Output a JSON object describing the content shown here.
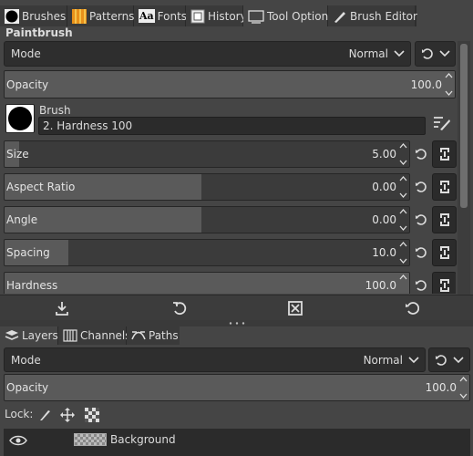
{
  "top_tabs": [
    {
      "label": "Brushes",
      "icon": "brushes-icon"
    },
    {
      "label": "Patterns",
      "icon": "patterns-icon"
    },
    {
      "label": "Fonts",
      "icon": "fonts-icon"
    },
    {
      "label": "History",
      "icon": "history-icon"
    },
    {
      "label": "Tool Options",
      "icon": "tool-options-icon"
    },
    {
      "label": "Brush Editor",
      "icon": "brush-editor-icon"
    }
  ],
  "fonts_icon_text": "Aa",
  "tool_options": {
    "tool_name": "Paintbrush",
    "mode_label": "Mode",
    "mode_value": "Normal",
    "opacity_label": "Opacity",
    "opacity_value": "100.0",
    "brush_label": "Brush",
    "brush_name": "2. Hardness 100",
    "size_label": "Size",
    "size_value": "5.00",
    "size_fraction": 0.02,
    "aspect_label": "Aspect Ratio",
    "aspect_value": "0.00",
    "aspect_fraction": 0.5,
    "angle_label": "Angle",
    "angle_value": "0.00",
    "angle_fraction": 0.5,
    "spacing_label": "Spacing",
    "spacing_value": "10.0",
    "spacing_fraction": 0.16,
    "hardness_label": "Hardness",
    "hardness_value": "100.0",
    "hardness_fraction": 1.0
  },
  "bottom_tabs": [
    {
      "label": "Layers",
      "icon": "layers-icon"
    },
    {
      "label": "Channels",
      "icon": "channels-icon"
    },
    {
      "label": "Paths",
      "icon": "paths-icon"
    }
  ],
  "layers": {
    "mode_label": "Mode",
    "mode_value": "Normal",
    "opacity_label": "Opacity",
    "opacity_value": "100.0",
    "lock_label": "Lock:",
    "layer_name": "Background"
  },
  "colors": {
    "background": "#454545",
    "field": "#2b2b2b",
    "slider_fill": "#5a5a5a",
    "text": "#dcdcdc"
  }
}
